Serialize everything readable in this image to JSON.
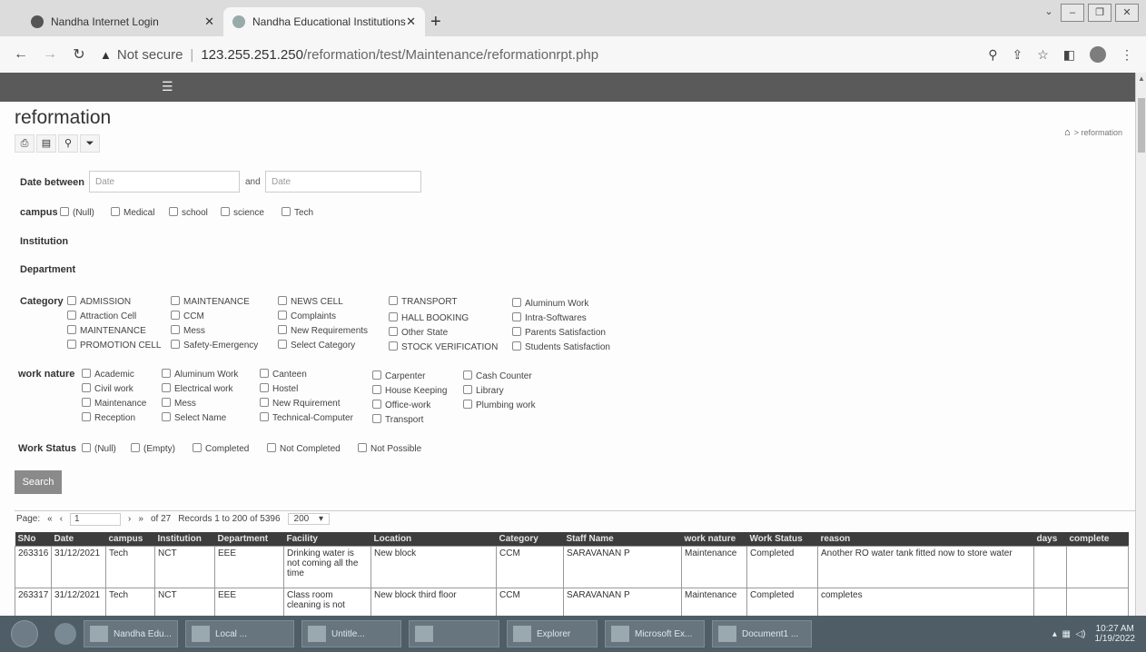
{
  "browser": {
    "tabs": [
      {
        "title": "Nandha Internet Login"
      },
      {
        "title": "Nandha Educational Institutions"
      }
    ],
    "new_tab": "+",
    "security": "Not secure",
    "url_host": "123.255.251.250",
    "url_path": "/reformation/test/Maintenance/reformationrpt.php"
  },
  "page": {
    "title": "reformation",
    "breadcrumb": "reformation",
    "filters": {
      "date_label": "Date between",
      "date_from_placeholder": "Date",
      "and_label": "and",
      "date_to_placeholder": "Date",
      "campus_label": "campus",
      "campus_options": [
        "(Null)",
        "Medical",
        "school",
        "science",
        "Tech"
      ],
      "institution_label": "Institution",
      "department_label": "Department",
      "category_label": "Category",
      "category_options": [
        "ADMISSION",
        "MAINTENANCE",
        "NEWS CELL",
        "TRANSPORT",
        "Aluminum Work",
        "Attraction Cell",
        "CCM",
        "Complaints",
        "HALL BOOKING",
        "Intra-Softwares",
        "MAINTENANCE",
        "Mess",
        "New Requirements",
        "Other State",
        "Parents Satisfaction",
        "PROMOTION CELL",
        "Safety-Emergency",
        "Select Category",
        "STOCK VERIFICATION",
        "Students Satisfaction"
      ],
      "work_nature_label": "work nature",
      "work_nature_options": [
        "Academic",
        "Aluminum Work",
        "Canteen",
        "Carpenter",
        "Cash Counter",
        "Civil work",
        "Electrical work",
        "Hostel",
        "House Keeping",
        "Library",
        "Maintenance",
        "Mess",
        "New Rquirement",
        "Office-work",
        "Plumbing work",
        "Reception",
        "Select Name",
        "Technical-Computer",
        "Transport"
      ],
      "work_status_label": "Work Status",
      "work_status_options": [
        "(Null)",
        "(Empty)",
        "Completed",
        "Not Completed",
        "Not Possible"
      ],
      "search_button": "Search"
    },
    "pager": {
      "page_label": "Page:",
      "page_value": "1",
      "of_pages": "of 27",
      "records": "Records 1 to 200 of 5396",
      "page_size": "200"
    },
    "table": {
      "columns": [
        "SNo",
        "Date",
        "campus",
        "Institution",
        "Department",
        "Facility",
        "Location",
        "Category",
        "Staff Name",
        "work nature",
        "Work Status",
        "reason",
        "days",
        "complete"
      ],
      "rows": [
        [
          "263316",
          "31/12/2021",
          "Tech",
          "NCT",
          "EEE",
          "Drinking water is not coming all the time",
          "New block",
          "CCM",
          "SARAVANAN P",
          "Maintenance",
          "Completed",
          "Another RO water tank fitted now to store water",
          "",
          ""
        ],
        [
          "263317",
          "31/12/2021",
          "Tech",
          "NCT",
          "EEE",
          "Class room cleaning is not",
          "New block third floor",
          "CCM",
          "SARAVANAN P",
          "Maintenance",
          "Completed",
          "completes",
          "",
          ""
        ]
      ]
    }
  },
  "taskbar": {
    "tasks": [
      "Nandha Edu...",
      "Local ...",
      "Untitle...",
      "",
      "Explorer",
      "Microsoft Ex...",
      "Document1 ..."
    ],
    "time": "10:27 AM",
    "date": "1/19/2022"
  }
}
